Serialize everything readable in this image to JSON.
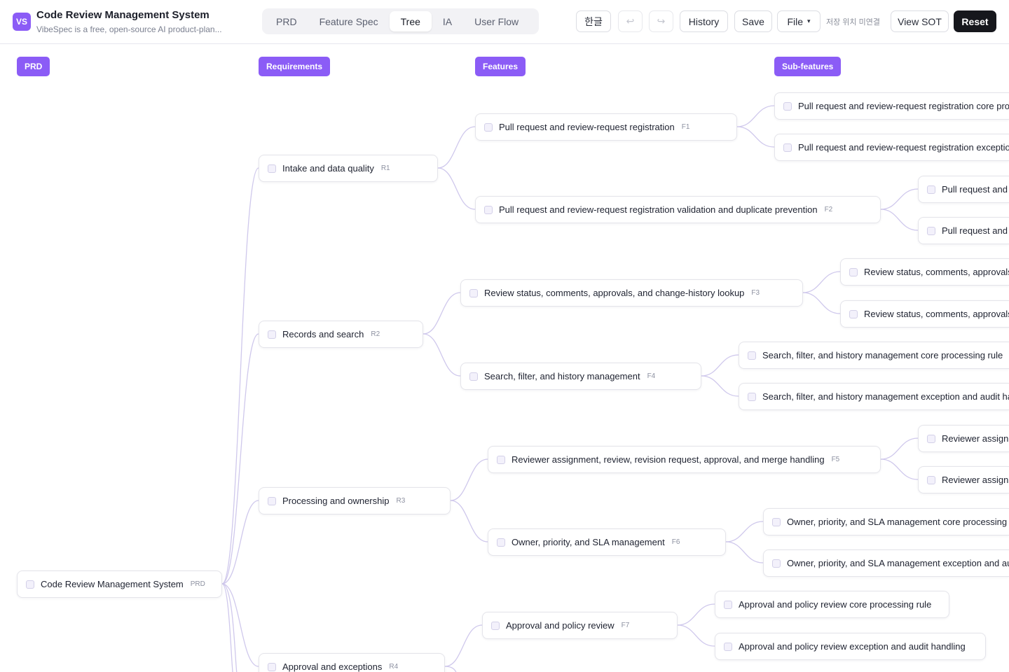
{
  "header": {
    "logo": "VS",
    "title": "Code Review Management System",
    "subtitle": "VibeSpec is a free, open-source AI product-plan..."
  },
  "tabs": [
    {
      "label": "PRD",
      "active": false
    },
    {
      "label": "Feature Spec",
      "active": false
    },
    {
      "label": "Tree",
      "active": true
    },
    {
      "label": "IA",
      "active": false
    },
    {
      "label": "User Flow",
      "active": false
    }
  ],
  "toolbar": {
    "language": "한글",
    "undo_icon": "↩",
    "redo_icon": "↪",
    "history": "History",
    "save": "Save",
    "file": "File",
    "file_caret": "▾",
    "save_status": "저장 위치 미연결",
    "view_sot": "View SOT",
    "reset": "Reset"
  },
  "columns": [
    "PRD",
    "Requirements",
    "Features",
    "Sub-features"
  ],
  "tree": {
    "root": {
      "label": "Code Review Management System",
      "tag": "PRD"
    },
    "requirements": [
      {
        "label": "Intake and data quality",
        "tag": "R1"
      },
      {
        "label": "Records and search",
        "tag": "R2"
      },
      {
        "label": "Processing and ownership",
        "tag": "R3"
      },
      {
        "label": "Approval and exceptions",
        "tag": "R4"
      }
    ],
    "features": [
      {
        "label": "Pull request and review-request registration",
        "tag": "F1"
      },
      {
        "label": "Pull request and review-request registration validation and duplicate prevention",
        "tag": "F2"
      },
      {
        "label": "Review status, comments, approvals, and change-history lookup",
        "tag": "F3"
      },
      {
        "label": "Search, filter, and history management",
        "tag": "F4"
      },
      {
        "label": "Reviewer assignment, review, revision request, approval, and merge handling",
        "tag": "F5"
      },
      {
        "label": "Owner, priority, and SLA management",
        "tag": "F6"
      },
      {
        "label": "Approval and policy review",
        "tag": "F7"
      }
    ],
    "subfeatures": [
      {
        "label": "Pull request and review-request registration core processing rule"
      },
      {
        "label": "Pull request and review-request registration exception and audit handling"
      },
      {
        "label": "Pull request and review-request registration validation and duplicate prevention core processing rule"
      },
      {
        "label": "Pull request and review-request registration validation and duplicate prevention exception and audit handling"
      },
      {
        "label": "Review status, comments, approvals, and change-history lookup core processing rule"
      },
      {
        "label": "Review status, comments, approvals, and change-history lookup exception and audit handling"
      },
      {
        "label": "Search, filter, and history management core processing rule"
      },
      {
        "label": "Search, filter, and history management exception and audit handling"
      },
      {
        "label": "Reviewer assignment, review, revision request, approval, and merge handling core processing rule"
      },
      {
        "label": "Reviewer assignment, review, revision request, approval, and merge handling exception and audit handling"
      },
      {
        "label": "Owner, priority, and SLA management core processing rule"
      },
      {
        "label": "Owner, priority, and SLA management exception and audit handling"
      },
      {
        "label": "Approval and policy review core processing rule"
      },
      {
        "label": "Approval and policy review exception and audit handling"
      }
    ]
  },
  "colors": {
    "accent": "#8b5cf6",
    "line": "#cfc8ec",
    "dark_button": "#16171c"
  }
}
